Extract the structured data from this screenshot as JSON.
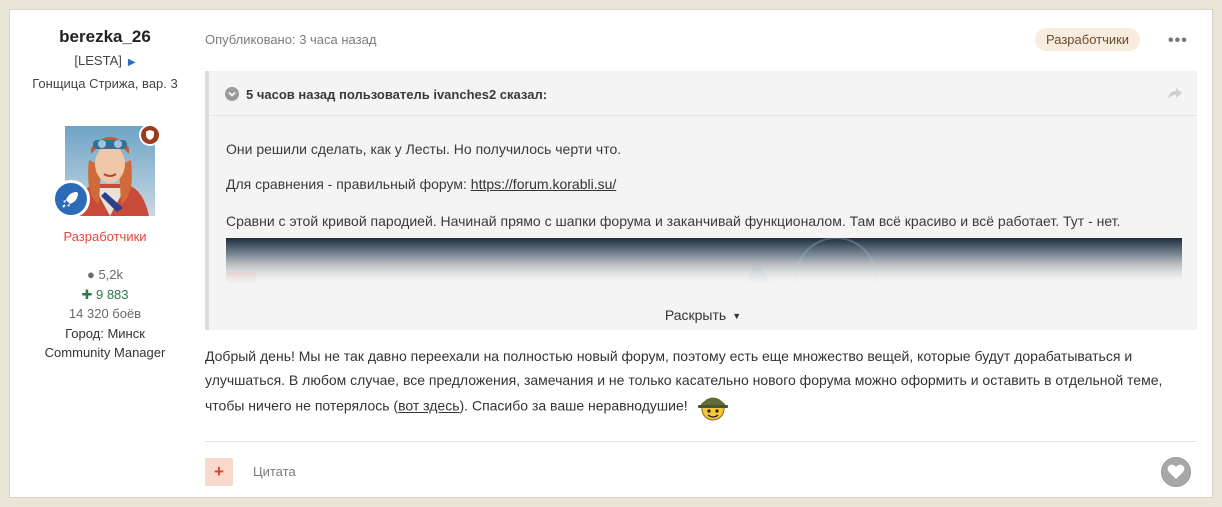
{
  "author": {
    "name": "berezka_26",
    "clan": "[LESTA]",
    "rank": "Гонщица Стрижа, вар. 3",
    "group": "Разработчики",
    "stats": {
      "comments": "5,2k",
      "reputation": "9 883",
      "battles": "14 320 боёв",
      "city": "Город: Минск",
      "role": "Community Manager"
    }
  },
  "post": {
    "published": "Опубликовано: 3 часа назад",
    "tag": "Разработчики",
    "menu_label": "•••"
  },
  "quote": {
    "author_line": "5 часов назад пользователь ivanches2 сказал:",
    "p1": "Они решили сделать, как у Лесты. Но получилось черти что.",
    "p2_prefix": "Для сравнения  - правильный форум: ",
    "p2_link": "https://forum.korabli.su/",
    "p3": "Сравни с этой кривой пародией. Начинай прямо с шапки форума и заканчивай функционалом. Там всё красиво и всё работает. Тут - нет.",
    "expand_label": "Раскрыть"
  },
  "body": {
    "text_before_link": "Добрый день! Мы не так давно переехали на полностью новый форум, поэтому есть еще множество вещей, которые будут дорабатываться и улучшаться. В любом случае, все предложения, замечания и не только касательно нового форума можно оформить и оставить в отдельной теме, чтобы ничего не потерялось (",
    "link_text": "вот здесь",
    "text_after_link": "). Спасибо за ваше неравнодушие!"
  },
  "footer": {
    "rep_label": "+",
    "quote_label": "Цитата"
  },
  "colors": {
    "background": "#e9e4d8",
    "group_red": "#e8453c",
    "reputation_green": "#2a7b4b",
    "tag_bg": "#f7ecde"
  }
}
